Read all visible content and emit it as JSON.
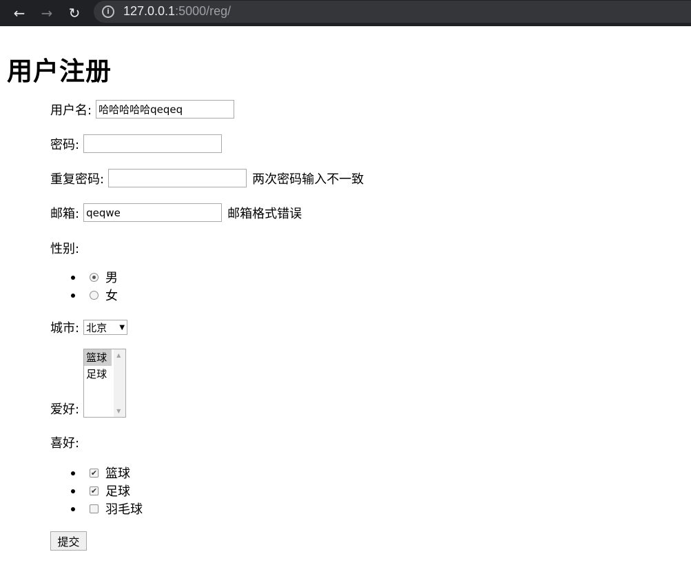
{
  "browser": {
    "url_host": "127.0.0.1",
    "url_path": ":5000/reg/"
  },
  "page": {
    "title": "用户注册"
  },
  "form": {
    "username": {
      "label": "用户名:",
      "value": "哈哈哈哈哈qeqeq"
    },
    "password": {
      "label": "密码:",
      "value": ""
    },
    "repeat_password": {
      "label": "重复密码:",
      "value": "",
      "error": "两次密码输入不一致"
    },
    "email": {
      "label": "邮箱:",
      "value": "qeqwe",
      "error": "邮箱格式错误"
    },
    "gender": {
      "label": "性别:",
      "options": [
        {
          "label": "男",
          "checked": true
        },
        {
          "label": "女",
          "checked": false
        }
      ]
    },
    "city": {
      "label": "城市:",
      "selected": "北京"
    },
    "hobby": {
      "label": "爱好:",
      "options": [
        {
          "label": "篮球",
          "selected": true
        },
        {
          "label": "足球",
          "selected": false
        }
      ]
    },
    "likes": {
      "label": "喜好:",
      "options": [
        {
          "label": "篮球",
          "checked": true
        },
        {
          "label": "足球",
          "checked": true
        },
        {
          "label": "羽毛球",
          "checked": false
        }
      ]
    },
    "submit_label": "提交"
  }
}
